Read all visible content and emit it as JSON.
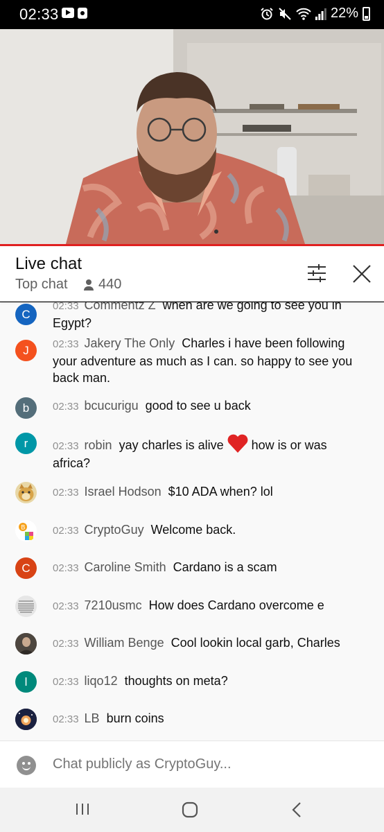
{
  "status_bar": {
    "time": "02:33",
    "battery": "22%"
  },
  "chat_header": {
    "title": "Live chat",
    "mode": "Top chat",
    "viewers": "440"
  },
  "messages": [
    {
      "time": "02:33",
      "author": "Commentz Z",
      "text": "when are we going to see you in Egypt?",
      "avatar": {
        "letter": "C",
        "color": "#1565c0"
      }
    },
    {
      "time": "02:33",
      "author": "Jakery The Only",
      "text": "Charles i have been following your adventure as much as I can. so happy to see you back man.",
      "avatar": {
        "letter": "J",
        "color": "#f4511e"
      }
    },
    {
      "time": "02:33",
      "author": "bcucurigu",
      "text": "good to see u back",
      "avatar": {
        "letter": "b",
        "color": "#546e7a"
      }
    },
    {
      "time": "02:33",
      "author": "robin",
      "text_before": "yay charles is alive",
      "text_after": "how is or was africa?",
      "avatar": {
        "letter": "r",
        "color": "#0097a7"
      }
    },
    {
      "time": "02:33",
      "author": "Israel Hodson",
      "text": "$10 ADA when? lol",
      "avatar": {
        "icon": "doge-avatar"
      }
    },
    {
      "time": "02:33",
      "author": "CryptoGuy",
      "text": "Welcome back.",
      "avatar": {
        "icon": "crypto-avatar"
      }
    },
    {
      "time": "02:33",
      "author": "Caroline Smith",
      "text": "Cardano is a scam",
      "avatar": {
        "letter": "C",
        "color": "#d84315"
      }
    },
    {
      "time": "02:33",
      "author": "7210usmc",
      "text": "How does Cardano overcome e",
      "avatar": {
        "icon": "document-avatar"
      }
    },
    {
      "time": "02:33",
      "author": "William Benge",
      "text": "Cool lookin local garb, Charles",
      "avatar": {
        "icon": "photo-avatar"
      }
    },
    {
      "time": "02:33",
      "author": "liqo12",
      "text": "thoughts on meta?",
      "avatar": {
        "letter": "l",
        "color": "#00897b"
      }
    },
    {
      "time": "02:33",
      "author": "LB",
      "text": "burn coins",
      "avatar": {
        "icon": "space-avatar"
      }
    }
  ],
  "input": {
    "placeholder": "Chat publicly as CryptoGuy..."
  }
}
